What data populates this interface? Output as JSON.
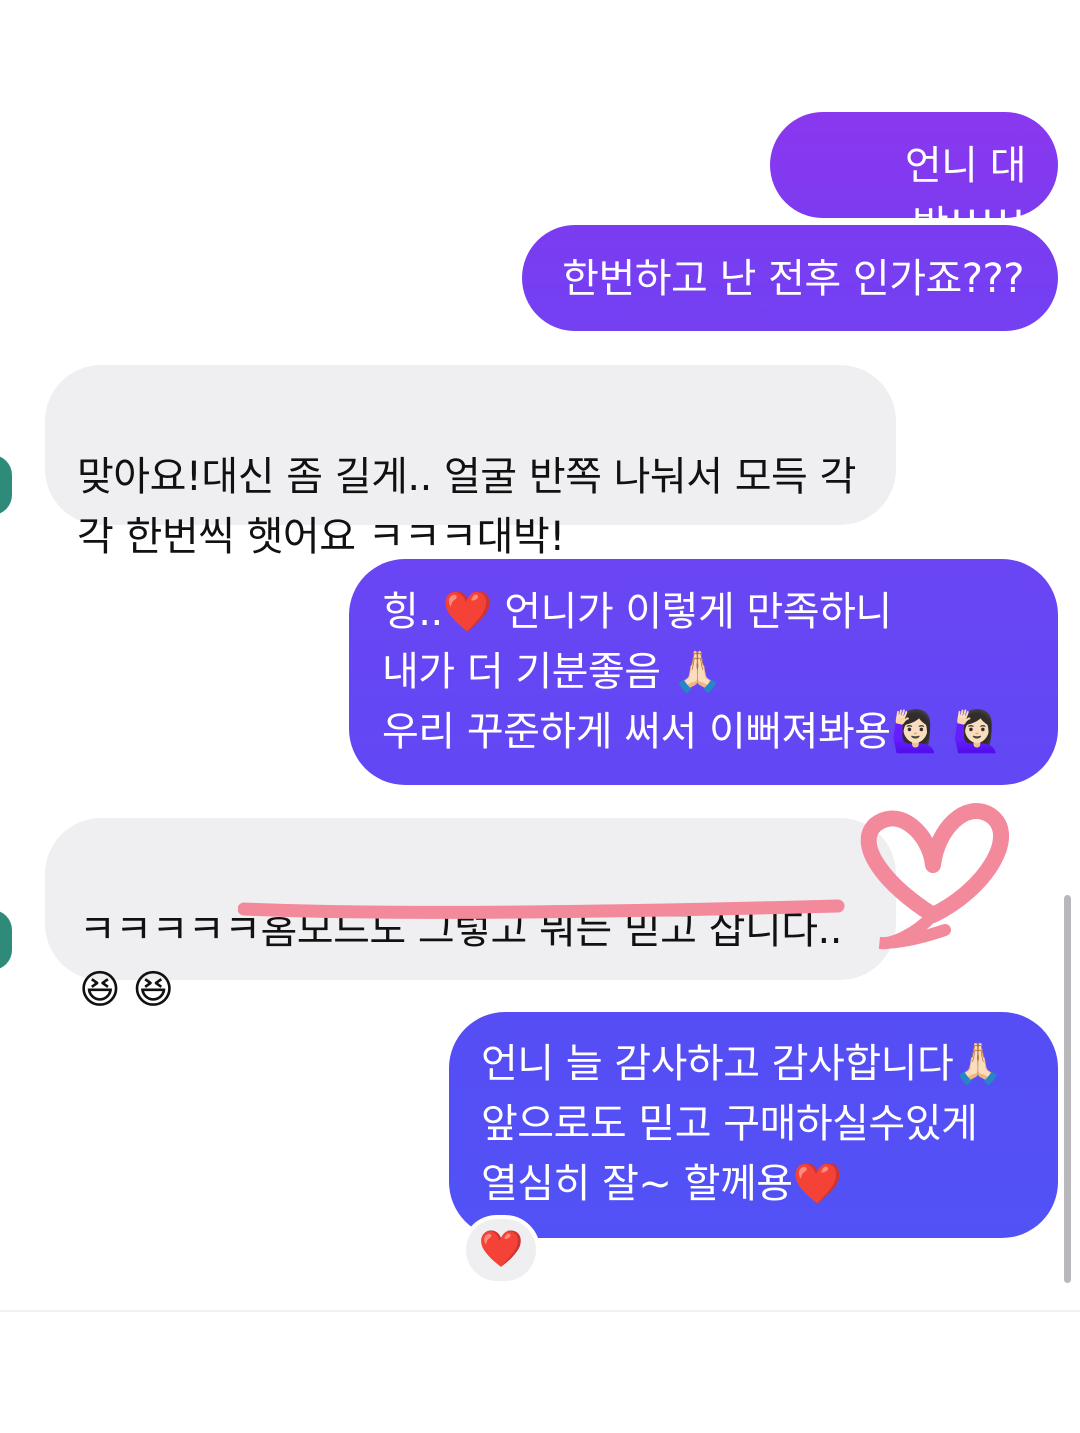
{
  "messages": [
    {
      "id": "m1",
      "side": "outgoing",
      "text": "언니 대박!!!!!"
    },
    {
      "id": "m2",
      "side": "outgoing",
      "text": "한번하고 난 전후 인가죠???"
    },
    {
      "id": "m3",
      "side": "incoming",
      "text": "맞아요!대신 좀 길게.. 얼굴 반쪽 나눠서 모득 각\n각 한번씩 햇어요 ㅋㅋㅋ대박!"
    },
    {
      "id": "m4",
      "side": "outgoing",
      "text": "힝..❤️  언니가 이렇게 만족하니\n내가 더 기분좋음 🙏🏻\n우리 꾸준하게 써서 이뻐져봐용🙋🏻‍♀️ 🙋🏻‍♀️"
    },
    {
      "id": "m5",
      "side": "incoming",
      "text": "ㅋㅋㅋㅋㅋ홈모드도 그렇고 뭐든 믿고 삽니다..\n😆 😆"
    },
    {
      "id": "m6",
      "side": "outgoing",
      "text": "언니 늘 감사하고 감사합니다🙏🏻\n앞으로도 믿고 구매하실수있게\n열심히 잘~ 할께용❤️"
    }
  ],
  "reaction": {
    "emoji": "❤️",
    "target": "m6"
  },
  "colors": {
    "outgoing_top": "#8a38ef",
    "outgoing_bottom": "#5152f6",
    "incoming_bg": "#efeff1",
    "annotation_pink": "#f28a9c",
    "avatar": "#2e8b7a"
  },
  "icons": {
    "reaction": "red-heart-icon",
    "annotation": "hand-drawn-heart-icon"
  }
}
